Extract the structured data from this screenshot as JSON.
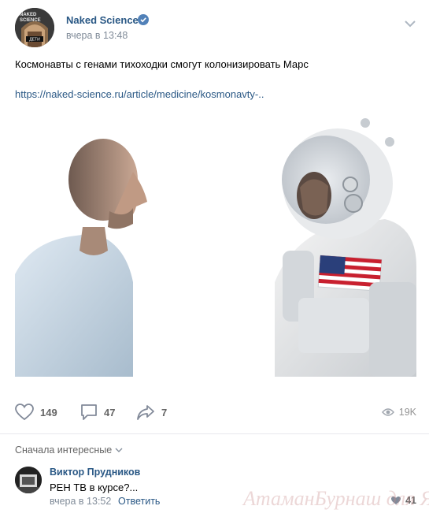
{
  "post": {
    "author": "Naked Science",
    "time": "вчера в 13:48",
    "text": "Космонавты с генами тихоходки смогут колонизировать Марс",
    "link": "https://naked-science.ru/article/medicine/kosmonavty-..",
    "avatar_text": {
      "line1": "NAKED",
      "line2": "SCIENCE",
      "badge": "ДЕТИ"
    }
  },
  "actions": {
    "likes": "149",
    "comments": "47",
    "shares": "7",
    "views": "19K"
  },
  "comments_section": {
    "sort_label": "Сначала интересные",
    "items": [
      {
        "author": "Виктор Прудников",
        "text": "РЕН ТВ в курсе?...",
        "time": "вчера в 13:52",
        "reply_label": "Ответить",
        "likes": "41"
      }
    ]
  },
  "watermark": "АтаманБурнаш для ЯП",
  "colors": {
    "link": "#2a5885",
    "meta": "#818c99",
    "action": "#656565",
    "verified": "#5181b8"
  }
}
